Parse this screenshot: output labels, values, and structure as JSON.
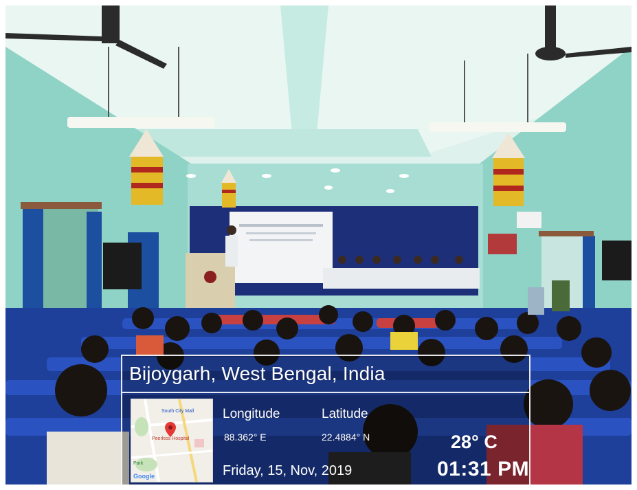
{
  "location": "Bijoygarh, West Bengal, India",
  "longitude": {
    "label": "Longitude",
    "value": "88.362° E"
  },
  "latitude": {
    "label": "Latitude",
    "value": "22.4884° N"
  },
  "date": "Friday, 15, Nov, 2019",
  "temperature": "28° C",
  "time": "01:31 PM",
  "map": {
    "place_1": "South City Mall",
    "place_2": "Peerless Hospital",
    "place_3": "Park",
    "brand": "Google",
    "pin_icon": "map-pin-icon"
  },
  "colors": {
    "wall": "#9fd6cc",
    "backdrop": "#1e2f7a",
    "chairs": "#2446b0",
    "overlay_text": "#ffffff"
  }
}
